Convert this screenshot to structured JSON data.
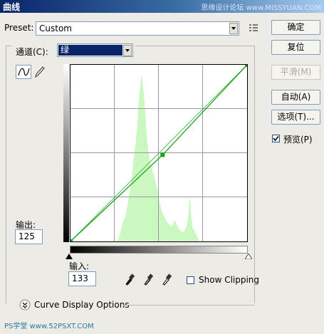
{
  "window": {
    "title": "曲线",
    "watermark": "思缘设计论坛 www.MISSYUAN.COM"
  },
  "preset": {
    "label": "Preset:",
    "value": "Custom"
  },
  "channel": {
    "label": "通道(C):",
    "value": "绿"
  },
  "buttons": {
    "ok": "确定",
    "reset": "复位",
    "smooth": "平滑(M)",
    "auto": "自动(A)",
    "options": "选项(T)...",
    "preview": "预览(P)"
  },
  "preview_checked": true,
  "output": {
    "label": "输出:",
    "value": "125"
  },
  "input": {
    "label": "输入:",
    "value": "133"
  },
  "show_clipping": {
    "label": "Show Clipping",
    "checked": false
  },
  "curve_display": {
    "label": "Curve Display Options"
  },
  "footer_watermark": "PS学堂 www.52PSXT.COM",
  "colors": {
    "histogram": "#cbf7c0",
    "curve": "#1aa31a",
    "selection": "#0a246a"
  },
  "curve_points": [
    {
      "in": 0,
      "out": 0
    },
    {
      "in": 133,
      "out": 125
    },
    {
      "in": 255,
      "out": 255
    }
  ],
  "histogram": [
    0,
    0,
    0,
    0,
    0,
    0,
    0,
    0,
    0,
    0,
    0,
    0,
    0,
    0,
    0,
    0,
    0,
    0,
    0,
    0,
    0,
    0,
    0,
    0,
    0,
    0,
    0,
    0,
    0,
    0,
    0,
    0,
    0,
    0,
    0,
    0,
    0,
    0,
    0,
    0,
    0,
    0,
    0,
    0,
    0,
    0,
    0,
    0,
    0,
    0,
    0,
    0,
    0,
    0,
    0,
    0,
    0,
    0,
    0,
    0,
    0,
    0,
    0,
    0,
    0,
    0,
    0,
    0,
    0,
    0,
    0,
    0,
    0,
    0,
    2,
    4,
    6,
    9,
    12,
    16,
    20,
    24,
    28,
    30,
    32,
    34,
    36,
    40,
    45,
    50,
    56,
    62,
    68,
    72,
    78,
    84,
    92,
    100,
    110,
    118,
    126,
    134,
    140,
    150,
    160,
    172,
    186,
    200,
    210,
    220,
    232,
    240,
    236,
    230,
    222,
    212,
    200,
    188,
    176,
    160,
    150,
    140,
    132,
    126,
    120,
    114,
    110,
    108,
    104,
    100,
    98,
    96,
    92,
    88,
    84,
    80,
    76,
    70,
    66,
    60,
    56,
    52,
    48,
    44,
    42,
    40,
    38,
    36,
    34,
    32,
    30,
    28,
    28,
    26,
    26,
    24,
    24,
    22,
    22,
    22,
    24,
    26,
    28,
    30,
    30,
    28,
    26,
    24,
    22,
    20,
    18,
    16,
    16,
    16,
    14,
    14,
    14,
    14,
    14,
    16,
    18,
    20,
    22,
    26,
    30,
    40,
    56,
    64,
    56,
    40,
    30,
    24,
    20,
    18,
    16,
    14,
    12,
    10,
    8,
    6,
    4,
    2,
    0,
    0,
    0,
    0,
    0,
    0,
    0,
    0,
    0,
    0,
    0,
    0,
    0,
    0,
    0,
    0,
    0,
    0,
    0,
    0,
    0,
    0,
    0,
    0,
    0,
    0,
    0,
    0,
    0,
    0,
    0,
    0,
    0,
    0,
    0,
    0,
    0,
    0,
    0,
    0,
    0,
    0,
    0,
    0,
    0,
    0,
    0,
    0,
    0,
    0,
    0,
    0,
    0,
    0,
    0,
    0,
    0,
    0,
    0,
    0,
    0,
    0,
    0,
    0,
    0,
    0,
    0,
    0,
    0,
    0,
    0,
    0,
    0,
    0,
    0,
    0
  ]
}
